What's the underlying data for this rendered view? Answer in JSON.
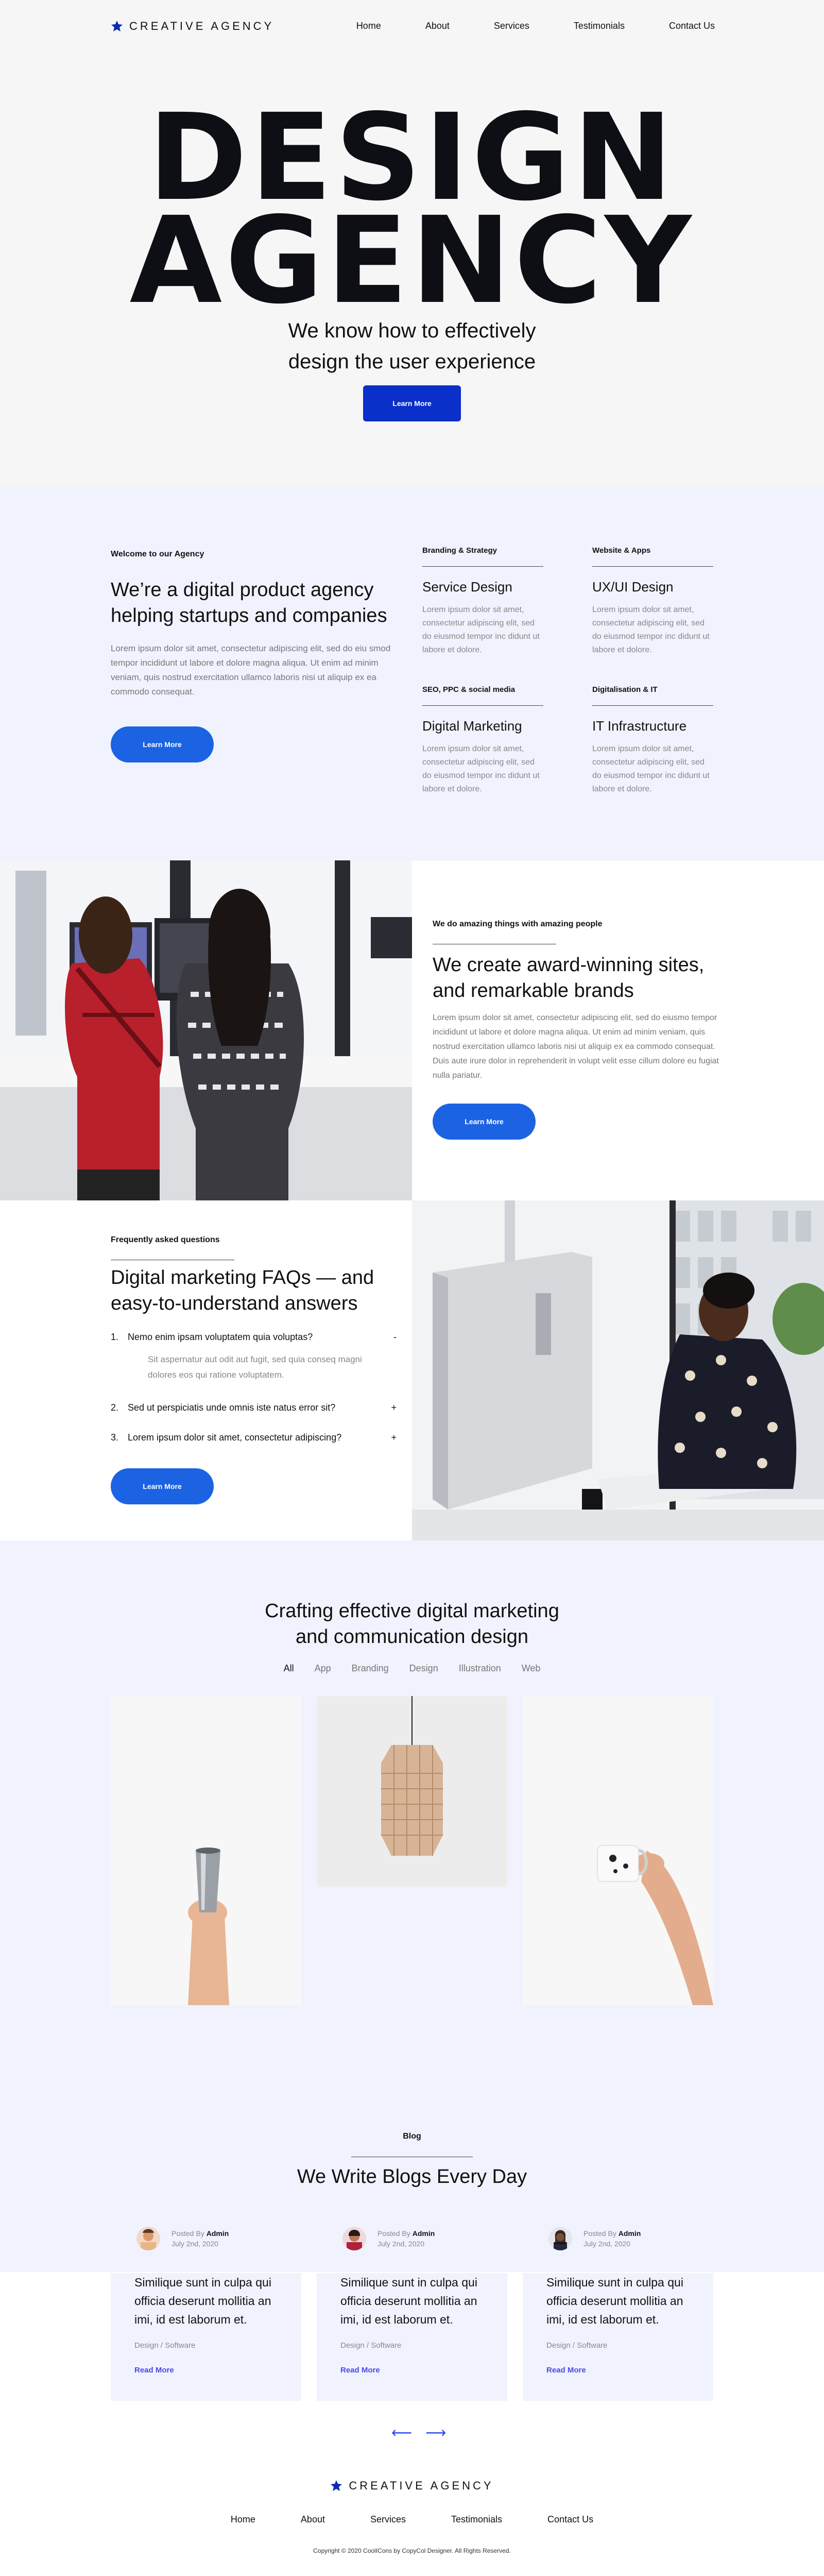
{
  "brand": {
    "name": "CREATIVE AGENCY",
    "accent": "#0b2fc9",
    "button_blue": "#1c63e3",
    "panel_bg": "#f0f3fd"
  },
  "nav": {
    "links": [
      "Home",
      "About",
      "Services",
      "Testimonials",
      "Contact Us"
    ]
  },
  "hero": {
    "line1": "DESIGN",
    "line2": "AGENCY",
    "subtitle_1": "We know how to effectively",
    "subtitle_2": "design the user experience",
    "button": "Learn More"
  },
  "about": {
    "eyebrow": "Welcome to our Agency",
    "title": "We’re a digital product agency helping startups and companies",
    "body": "Lorem ipsum dolor sit amet, consectetur adipiscing elit, sed do eiu smod tempor incididunt ut labore et dolore magna aliqua. Ut enim ad minim veniam, quis nostrud exercitation ullamco laboris nisi ut aliquip ex ea commodo consequat.",
    "button": "Learn More",
    "services": [
      {
        "category": "Branding & Strategy",
        "title": "Service Design",
        "desc": "Lorem ipsum dolor sit amet, consectetur adipiscing elit, sed do eiusmod tempor inc didunt ut labore et dolore."
      },
      {
        "category": "Website & Apps",
        "title": "UX/UI Design",
        "desc": "Lorem ipsum dolor sit amet, consectetur adipiscing elit, sed do eiusmod tempor inc didunt ut labore et dolore."
      },
      {
        "category": "SEO, PPC & social media",
        "title": "Digital Marketing",
        "desc": "Lorem ipsum dolor sit amet, consectetur adipiscing elit, sed do eiusmod tempor inc didunt ut labore et dolore."
      },
      {
        "category": "Digitalisation & IT",
        "title": "IT Infrastructure",
        "desc": "Lorem ipsum dolor sit amet, consectetur adipiscing elit, sed do eiusmod tempor inc didunt ut labore et dolore."
      }
    ]
  },
  "awards": {
    "eyebrow": "We do amazing things with amazing people",
    "title": "We create award-winning sites, and remarkable brands",
    "body": "Lorem ipsum dolor sit amet, consectetur adipiscing elit, sed do eiusmo tempor incididunt ut labore et dolore magna aliqua. Ut enim ad minim veniam, quis nostrud exercitation ullamco laboris nisi ut aliquip ex ea commodo consequat. Duis aute irure dolor in reprehenderit in volupt velit esse cillum dolore eu fugiat nulla pariatur.",
    "button": "Learn More"
  },
  "faq": {
    "eyebrow": "Frequently asked questions",
    "title": "Digital marketing FAQs — and easy-to-understand answers",
    "items": [
      {
        "num": "1.",
        "q": "Nemo enim ipsam voluptatem quia voluptas?",
        "sign": "-",
        "a": "Sit aspernatur aut odit aut fugit, sed quia conseq magni dolores eos qui ratione voluptatem."
      },
      {
        "num": "2.",
        "q": "Sed ut perspiciatis unde omnis iste natus error sit?",
        "sign": "+"
      },
      {
        "num": "3.",
        "q": "Lorem ipsum dolor sit amet, consectetur adipiscing?",
        "sign": "+"
      }
    ],
    "button": "Learn More"
  },
  "portfolio": {
    "title_1": "Crafting effective digital marketing",
    "title_2": "and communication design",
    "filters": [
      "All",
      "App",
      "Branding",
      "Design",
      "Illustration",
      "Web"
    ],
    "active_filter": "All"
  },
  "blog": {
    "eyebrow": "Blog",
    "title": "We Write Blogs Every Day",
    "posts": [
      {
        "posted_by": "Posted By",
        "author": "Admin",
        "date": "July 2nd, 2020",
        "title": "Similique sunt in culpa qui officia deserunt mollitia an imi, id est laborum et.",
        "category": "Design / Software",
        "link": "Read More"
      },
      {
        "posted_by": "Posted By",
        "author": "Admin",
        "date": "July 2nd, 2020",
        "title": "Similique sunt in culpa qui officia deserunt mollitia an imi, id est laborum et.",
        "category": "Design / Software",
        "link": "Read More"
      },
      {
        "posted_by": "Posted By",
        "author": "Admin",
        "date": "July 2nd, 2020",
        "title": "Similique sunt in culpa qui officia deserunt mollitia an imi, id est laborum et.",
        "category": "Design / Software",
        "link": "Read More"
      }
    ],
    "prev_icon": "arrow-left-icon",
    "next_icon": "arrow-right-icon"
  },
  "footer": {
    "brand": "CREATIVE AGENCY",
    "links": [
      "Home",
      "About",
      "Services",
      "Testimonials",
      "Contact Us"
    ],
    "copyright": "Copyright © 2020 CoolICons by CopyCol Designer. All Rights Reserved."
  }
}
